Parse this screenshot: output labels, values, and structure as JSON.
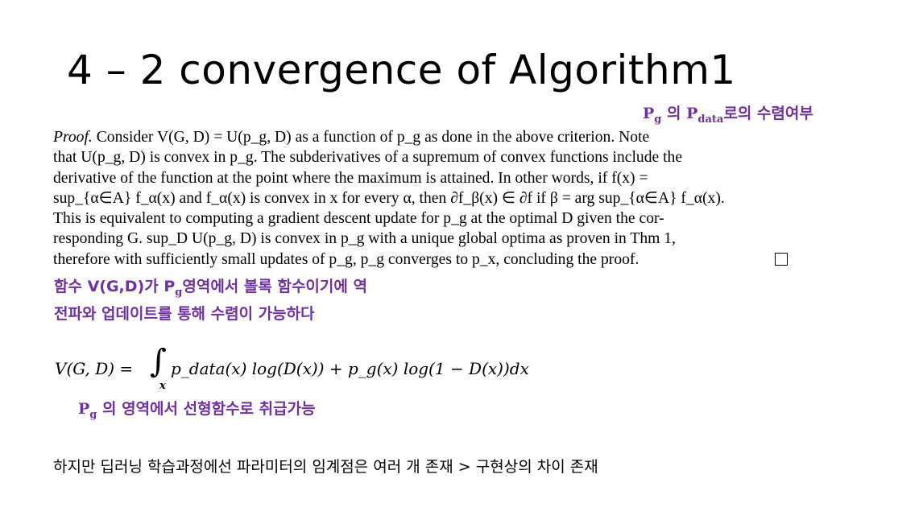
{
  "slide": {
    "title": "4 – 2 convergence of Algorithm1"
  },
  "annotations": {
    "convergence_pg": "P",
    "convergence_pg_sub": "g",
    "convergence_mid": " 의 P",
    "convergence_data_sub": "data",
    "convergence_tail": "로의 수렴여부",
    "convex_head": "함수 V(G,D)가 P",
    "convex_sub": "g",
    "convex_tail": "영역에서 볼록 함수이기에 역\n전파와 업데이트를 통해 수렴이 가능하다",
    "linear_head": "P",
    "linear_sub": "g",
    "linear_tail": " 의 영역에서 선형함수로 취급가능"
  },
  "proof": {
    "lead": "Proof.",
    "body": " Consider V(G, D) = U(p_g, D) as a function of p_g as done in the above criterion.  Note\nthat U(p_g, D) is convex in p_g. The subderivatives of a supremum of convex functions include the\nderivative of the function at the point where the maximum is attained.  In other words, if f(x) =\nsup_{α∈A} f_α(x) and f_α(x) is convex in x for every α, then ∂f_β(x) ∈ ∂f if β = arg sup_{α∈A} f_α(x).\nThis is equivalent to computing a gradient descent update for p_g at the optimal D given the cor-\nresponding G.  sup_D U(p_g, D) is convex in p_g with a unique global optima as proven in Thm 1,\ntherefore with sufficiently small updates of p_g, p_g converges to p_x, concluding the proof."
  },
  "equation": {
    "lhs": "V(G, D)  =",
    "integral": "∫",
    "integral_sub": "x",
    "rhs": "p_data(x) log(D(x)) + p_g(x) log(1 − D(x))dx"
  },
  "bottom_note": "하지만 딥러닝 학습과정에선 파라미터의 임계점은 여러 개 존재 > 구현상의 차이 존재"
}
